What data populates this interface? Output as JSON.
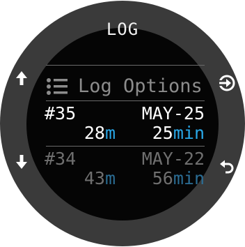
{
  "screen": {
    "title": "LOG"
  },
  "menu": {
    "option_label": "Log Options",
    "option_icon": "list-icon"
  },
  "entries": [
    {
      "number": "#35",
      "date": "MAY-25",
      "depth_value": "28",
      "depth_unit": "m",
      "time_value": "25",
      "time_unit": "min",
      "selected": true
    },
    {
      "number": "#34",
      "date": "MAY-22",
      "depth_value": "43",
      "depth_unit": "m",
      "time_value": "56",
      "time_unit": "min",
      "selected": false
    }
  ],
  "buttons": {
    "top_left": "up-arrow-icon",
    "bottom_left": "down-arrow-icon",
    "top_right": "enter-icon",
    "bottom_right": "back-icon"
  },
  "colors": {
    "accent": "#29a8e8",
    "bezel": "#3a3a3a",
    "screen": "#050505"
  }
}
